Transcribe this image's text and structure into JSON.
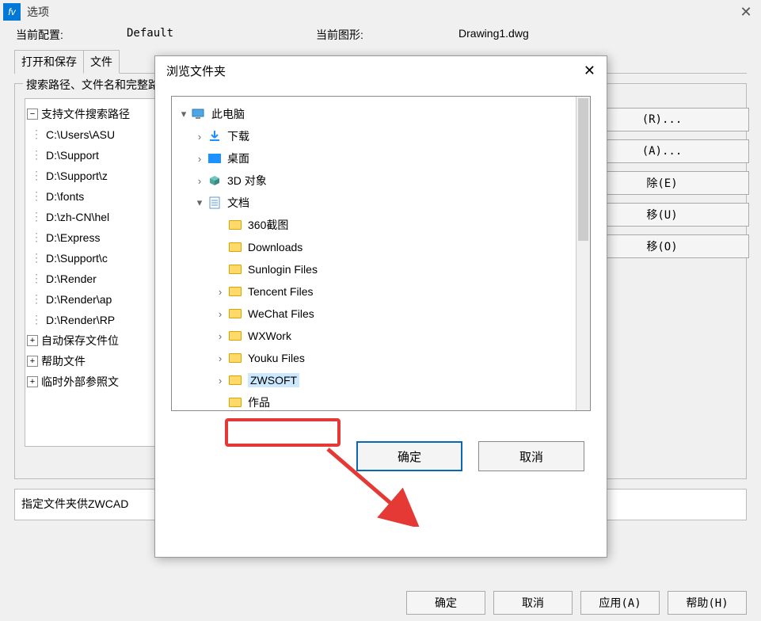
{
  "window": {
    "title": "选项",
    "config_label": "当前配置:",
    "config_value": "Default",
    "drawing_label": "当前图形:",
    "drawing_value": "Drawing1.dwg"
  },
  "tabs": {
    "tab1": "打开和保存",
    "tab2": "文件"
  },
  "group": {
    "title": "搜索路径、文件名和完整路径",
    "desc": "指定文件夹供ZWCAD"
  },
  "tree": {
    "root": "支持文件搜索路径",
    "p0": "C:\\Users\\ASU",
    "p1": "D:\\Support",
    "p2": "D:\\Support\\z",
    "p3": "D:\\fonts",
    "p4": "D:\\zh-CN\\hel",
    "p5": "D:\\Express",
    "p6": "D:\\Support\\c",
    "p7": "D:\\Render",
    "p8": "D:\\Render\\ap",
    "p9": "D:\\Render\\RP",
    "n1": "自动保存文件位",
    "n2": "帮助文件",
    "n3": "临时外部参照文"
  },
  "side": {
    "browse": "(R)...",
    "add": "(A)...",
    "remove": "除(E)",
    "up": "移(U)",
    "down": "移(O)"
  },
  "bottom": {
    "ok": "确定",
    "cancel": "取消",
    "apply": "应用(A)",
    "help": "帮助(H)"
  },
  "dialog": {
    "title": "浏览文件夹",
    "ok": "确定",
    "cancel": "取消"
  },
  "ftree": {
    "thispc": "此电脑",
    "downloads": "下载",
    "desktop": "桌面",
    "objects3d": "3D 对象",
    "documents": "文档",
    "d1": "360截图",
    "d2": "Downloads",
    "d3": "Sunlogin Files",
    "d4": "Tencent Files",
    "d5": "WeChat Files",
    "d6": "WXWork",
    "d7": "Youku Files",
    "d8": "ZWSOFT",
    "d9": "作品"
  }
}
